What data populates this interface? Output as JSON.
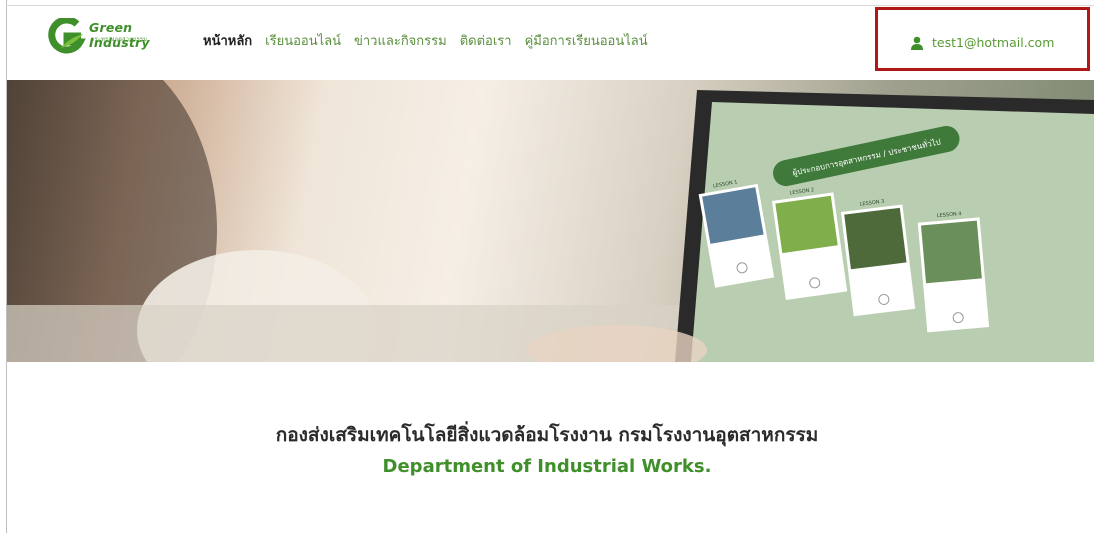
{
  "header": {
    "logo": {
      "title": "Green Industry",
      "subtitle": "กระทรวงอุตสาหกรรม"
    },
    "nav": [
      {
        "label": "หน้าหลัก",
        "active": true
      },
      {
        "label": "เรียนออนไลน์",
        "active": false
      },
      {
        "label": "ข่าวและกิจกรรม",
        "active": false
      },
      {
        "label": "ติดต่อเรา",
        "active": false
      },
      {
        "label": "คู่มือการเรียนออนไลน์",
        "active": false
      }
    ],
    "user": {
      "icon": "user-icon",
      "email": "test1@hotmail.com"
    }
  },
  "hero": {
    "laptop_screen": {
      "banner": "ผู้ประกอบการอุตสาหกรรม / ประชาชนทั่วไป",
      "lessons": [
        "LESSON 1",
        "LESSON 2",
        "LESSON 3",
        "LESSON 4"
      ]
    }
  },
  "department": {
    "thai_name": "กองส่งเสริมเทคโนโลยีสิ่งแวดล้อมโรงงาน กรมโรงงานอุตสาหกรรม",
    "english_name": "Department of Industrial Works."
  },
  "colors": {
    "brand_green": "#3f8f2a",
    "highlight_border": "#b01818"
  }
}
